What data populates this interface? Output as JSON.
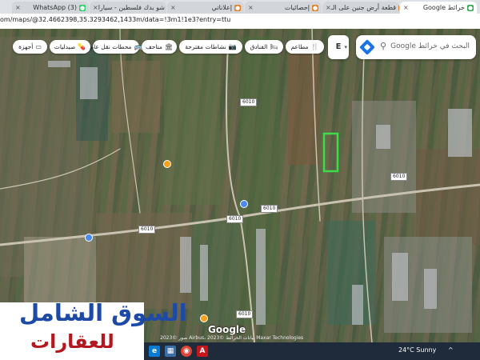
{
  "browser": {
    "tabs": [
      {
        "label": "خرائط Google",
        "icon": "google-maps-icon",
        "close": "×",
        "active": true
      },
      {
        "label": "قطعة أرض جنين على الـ",
        "icon": "listing-site-icon",
        "close": "×",
        "active": false
      },
      {
        "label": "إحصائيات",
        "icon": "stats-icon",
        "close": "×",
        "active": false
      },
      {
        "label": "إعلاناتي",
        "icon": "ads-icon",
        "close": "×",
        "active": false
      },
      {
        "label": "شو بدك فلسطين - سيارا",
        "icon": "site-icon",
        "close": "×",
        "active": false
      },
      {
        "label": "(3) WhatsApp",
        "icon": "whatsapp-icon",
        "close": "×",
        "active": false
      }
    ],
    "url": "om/maps/@32.4662398,35.3293462,1433m/data=!3m1!1e3?entry=ttu"
  },
  "search": {
    "placeholder": "البحث في خرائط Google",
    "search_icon": "search-icon",
    "directions_icon": "directions-icon"
  },
  "keyboard_button": {
    "label": "E",
    "arrow": "▾"
  },
  "chips": [
    {
      "label": "مطاعم",
      "icon": "restaurant-icon",
      "glyph": "🍴"
    },
    {
      "label": "الفنادق",
      "icon": "hotel-icon",
      "glyph": "🛏"
    },
    {
      "label": "نشاطات مقترحة",
      "icon": "activities-icon",
      "glyph": "📷"
    },
    {
      "label": "متاحف",
      "icon": "museum-icon",
      "glyph": "🏛"
    },
    {
      "label": "محطات نقل عام",
      "icon": "transit-icon",
      "glyph": "🚌"
    },
    {
      "label": "صيدليات",
      "icon": "pharmacy-icon",
      "glyph": "💊"
    },
    {
      "label": "أجهزة",
      "icon": "atm-icon",
      "glyph": "▭"
    }
  ],
  "map": {
    "road_labels": [
      "6010",
      "6010",
      "6010",
      "6010",
      "6010",
      "6010"
    ],
    "google_logo": "Google",
    "attribution": "صور ©2023 Airbus، بيانات الخرائط ©2023 Maxar Technologies",
    "colors": {
      "highlight": "#3ddc4a",
      "road": "#c9c2b0"
    }
  },
  "watermark": {
    "line1": "السوق الشامل",
    "line2": "للعقارات",
    "colors": {
      "line1": "#1d4aa6",
      "line2": "#b5171f"
    }
  },
  "taskbar": {
    "weather": "24°C Sunny",
    "tray": "^",
    "apps": [
      {
        "name": "edge-icon",
        "glyph": "e"
      },
      {
        "name": "store-icon",
        "glyph": "▦"
      },
      {
        "name": "chrome-icon",
        "glyph": "◉"
      },
      {
        "name": "acrobat-icon",
        "glyph": "A"
      }
    ]
  }
}
